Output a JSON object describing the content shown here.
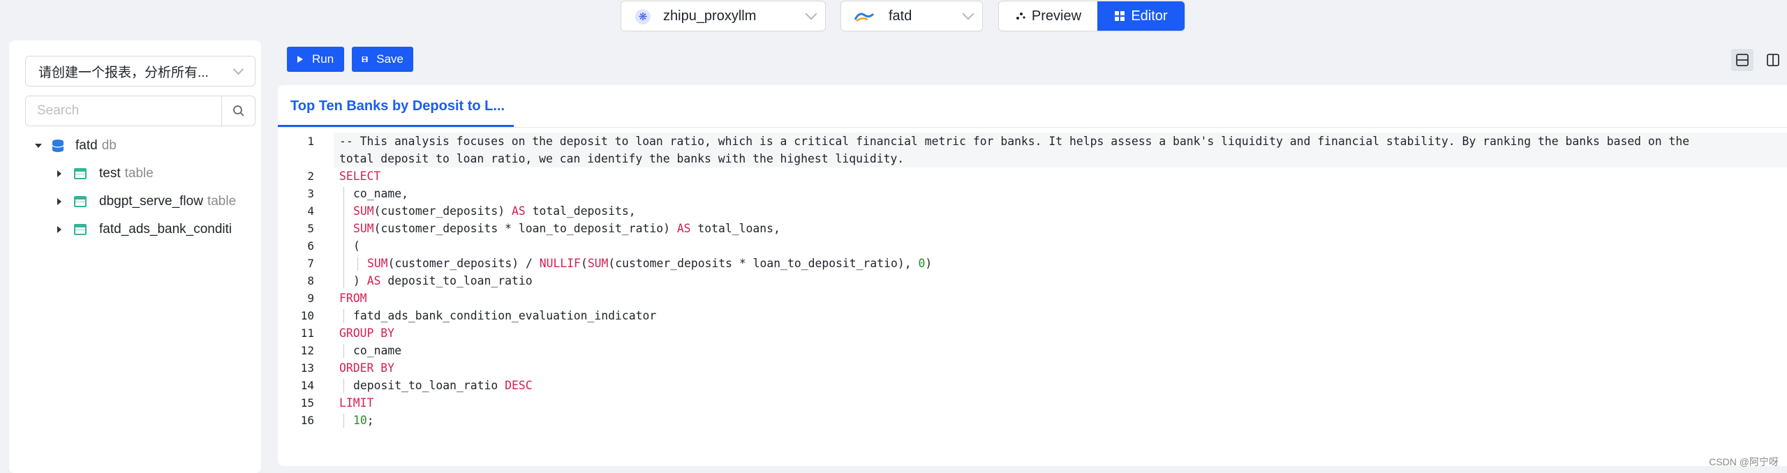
{
  "header": {
    "model_select": {
      "value": "zhipu_proxyllm",
      "icon": "model-icon"
    },
    "db_select": {
      "value": "fatd",
      "icon": "database-logo-icon"
    },
    "view_toggle": {
      "preview_label": "Preview",
      "editor_label": "Editor",
      "active": "Editor"
    }
  },
  "sidebar": {
    "chart_select": {
      "value": "请创建一个报表，分析所有..."
    },
    "search": {
      "placeholder": "Search"
    },
    "tree": {
      "root": {
        "name": "fatd",
        "type": "db"
      },
      "children": [
        {
          "name": "test",
          "type": "table"
        },
        {
          "name": "dbgpt_serve_flow",
          "type": "table"
        },
        {
          "name": "fatd_ads_bank_conditi",
          "type": ""
        }
      ]
    }
  },
  "toolbar": {
    "run_label": "Run",
    "save_label": "Save"
  },
  "editor": {
    "tab_title": "Top Ten Banks by Deposit to L...",
    "line_numbers": [
      "1",
      "2",
      "3",
      "4",
      "5",
      "6",
      "7",
      "8",
      "9",
      "10",
      "11",
      "12",
      "13",
      "14",
      "15",
      "16"
    ],
    "comment_line1": "-- This analysis focuses on the deposit to loan ratio, which is a critical financial metric for banks. It helps assess a bank's liquidity and financial stability. By ranking the banks based on the",
    "comment_line1_wrap": "total deposit to loan ratio, we can identify the banks with the highest liquidity.",
    "kw_select": "SELECT",
    "l3": "co_name,",
    "l4_fn": "SUM",
    "l4_rest": "(customer_deposits) ",
    "l4_as": "AS",
    "l4_tail": " total_deposits,",
    "l5_fn": "SUM",
    "l5_rest": "(customer_deposits * loan_to_deposit_ratio) ",
    "l5_as": "AS",
    "l5_tail": " total_loans,",
    "l6": "(",
    "l7_fn": "SUM",
    "l7_a": "(customer_deposits) / ",
    "l7_fn2": "NULLIF",
    "l7_b": "(",
    "l7_fn3": "SUM",
    "l7_c": "(customer_deposits * loan_to_deposit_ratio), ",
    "l7_num": "0",
    "l7_d": ")",
    "l8_a": ") ",
    "l8_as": "AS",
    "l8_tail": " deposit_to_loan_ratio",
    "kw_from": "FROM",
    "l10": "fatd_ads_bank_condition_evaluation_indicator",
    "kw_group": "GROUP BY",
    "l12": "co_name",
    "kw_order": "ORDER BY",
    "l14": "deposit_to_loan_ratio ",
    "l14_kw": "DESC",
    "kw_limit": "LIMIT",
    "l16_num": "10",
    "l16_tail": ";"
  },
  "watermark": "CSDN @阿宁呀"
}
